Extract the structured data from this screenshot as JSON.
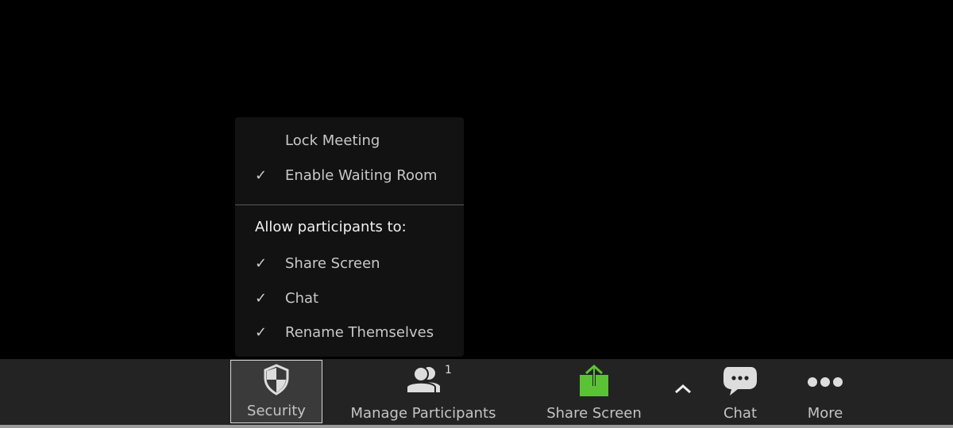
{
  "security_menu": {
    "items": [
      {
        "label": "Lock Meeting",
        "checked": false
      },
      {
        "label": "Enable Waiting Room",
        "checked": true
      }
    ],
    "section_title": "Allow participants to:",
    "participant_items": [
      {
        "label": "Share Screen",
        "checked": true
      },
      {
        "label": "Chat",
        "checked": true
      },
      {
        "label": "Rename Themselves",
        "checked": true
      }
    ],
    "check_glyph": "✓"
  },
  "toolbar": {
    "security": "Security",
    "participants": "Manage Participants",
    "participant_count": "1",
    "share": "Share Screen",
    "chat": "Chat",
    "more": "More",
    "share_color": "#5bc236"
  }
}
